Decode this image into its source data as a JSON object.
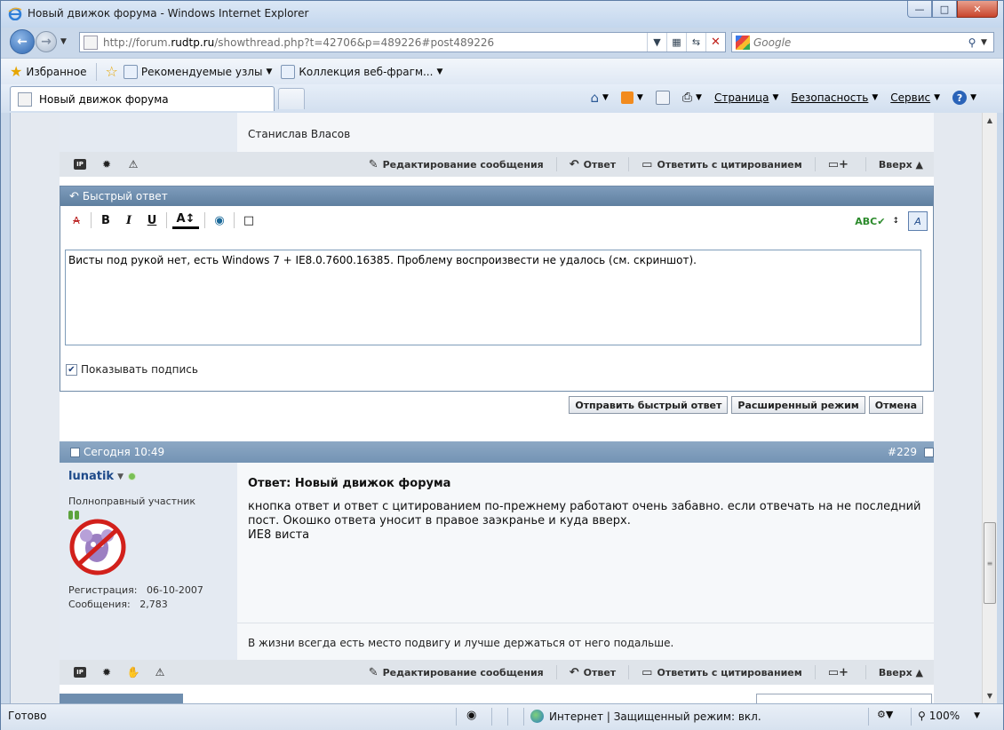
{
  "window": {
    "title": "Новый движок форума - Windows Internet Explorer"
  },
  "address": {
    "url_prefix": "http://forum.",
    "url_host": "rudtp.ru",
    "url_suffix": "/showthread.php?t=42706&p=489226#post489226"
  },
  "search": {
    "placeholder": "Google"
  },
  "favorites": {
    "favorites_label": "Избранное",
    "suggested_label": "Рекомендуемые узлы",
    "gallery_label": "Коллекция веб-фрагм..."
  },
  "tab": {
    "label": "Новый движок форума"
  },
  "command_bar": {
    "page": "Страница",
    "safety": "Безопасность",
    "tools": "Сервис"
  },
  "prev_post": {
    "signature": "Станислав Власов"
  },
  "post_actions": {
    "edit": "Редактирование сообщения",
    "reply": "Ответ",
    "quote": "Ответить с цитированием",
    "up": "Вверх"
  },
  "quick_reply": {
    "header": "Быстрый ответ",
    "text": "Висты под рукой нет, есть Windows 7 + IE8.0.7600.16385. Проблему воспроизвести не удалось (см. скриншот).",
    "show_signature": "Показывать подпись",
    "submit": "Отправить быстрый ответ",
    "advanced": "Расширенный режим",
    "cancel": "Отмена"
  },
  "post": {
    "date": "Сегодня 10:49",
    "number": "#229",
    "username": "lunatik",
    "rank": "Полноправный участник",
    "reg_label": "Регистрация:",
    "reg_date": "06-10-2007",
    "msgs_label": "Сообщения:",
    "msgs_count": "2,783",
    "title": "Ответ: Новый движок форума",
    "body": "кнопка ответ и ответ с цитированием по-прежнему работают очень забавно. если отвечать на не последний пост. Окошко ответа уносит в правое заэкранье и куда вверх.",
    "body_line2": "ИЕ8 виста",
    "signature": "В жизни всегда есть место подвигу и лучше держаться от него подальше."
  },
  "status": {
    "ready": "Готово",
    "zone": "Интернет | Защищенный режим: вкл.",
    "zoom": "100%"
  },
  "colors": {
    "accent": "#7393b4",
    "link": "#1e4a8a"
  }
}
